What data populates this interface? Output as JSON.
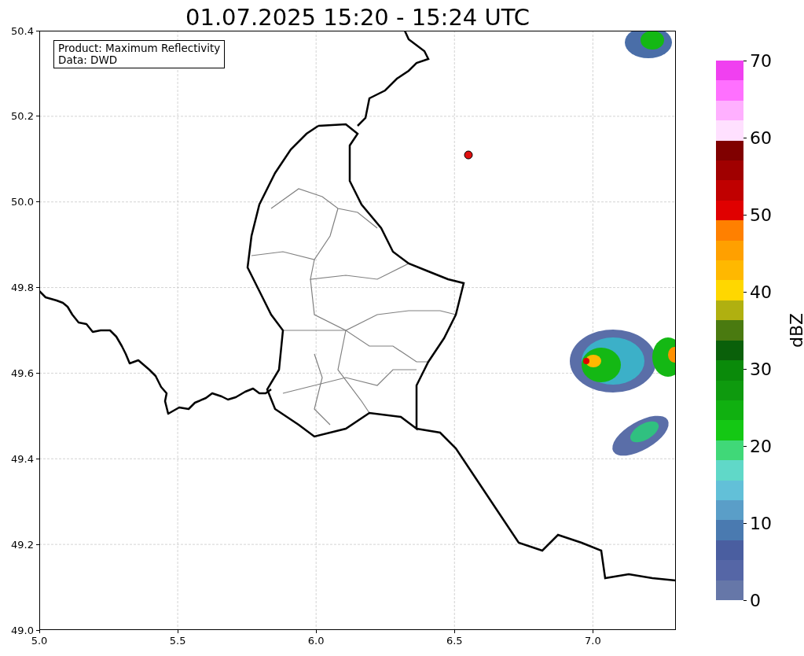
{
  "title": "01.07.2025 15:20 - 15:24 UTC",
  "map": {
    "info_box": [
      "Product: Maximum Reflectivity",
      "Data: DWD"
    ],
    "xticks": [
      "5.0",
      "5.5",
      "6.0",
      "6.5",
      "7.0"
    ],
    "yticks": [
      "50.4",
      "50.2",
      "50.0",
      "49.8",
      "49.6",
      "49.4",
      "49.2",
      "49.0"
    ]
  },
  "colorbar": {
    "label": "dBZ",
    "ticks": [
      "70",
      "60",
      "50",
      "40",
      "30",
      "20",
      "10",
      "0"
    ],
    "bands": [
      {
        "color": "#f040f0"
      },
      {
        "color": "#ff70ff"
      },
      {
        "color": "#ffb0ff"
      },
      {
        "color": "#ffe0ff"
      },
      {
        "color": "#800000"
      },
      {
        "color": "#a00000"
      },
      {
        "color": "#c00000"
      },
      {
        "color": "#e00000"
      },
      {
        "color": "#ff8000"
      },
      {
        "color": "#ffa000"
      },
      {
        "color": "#ffb800"
      },
      {
        "color": "#ffd700"
      },
      {
        "color": "#b0b010"
      },
      {
        "color": "#4a7a10"
      },
      {
        "color": "#0a600a"
      },
      {
        "color": "#0a8a0a"
      },
      {
        "color": "#0e9a0e"
      },
      {
        "color": "#10b010"
      },
      {
        "color": "#14c814"
      },
      {
        "color": "#40d878"
      },
      {
        "color": "#60d8c8"
      },
      {
        "color": "#62c0d8"
      },
      {
        "color": "#5a9ec8"
      },
      {
        "color": "#4a7ab0"
      },
      {
        "color": "#4a5ea0"
      },
      {
        "color": "#5566a6"
      },
      {
        "color": "#6677a8"
      }
    ]
  }
}
